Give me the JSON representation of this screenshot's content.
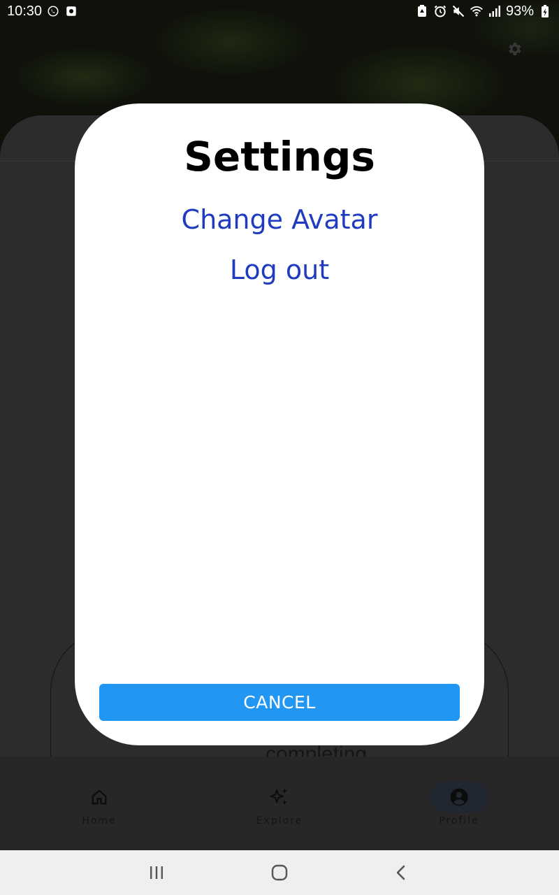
{
  "status_bar": {
    "time": "10:30",
    "battery_pct": "93%",
    "icons": [
      "whatsapp-icon",
      "notification-icon",
      "battery-saver-icon",
      "alarm-icon",
      "mute-icon",
      "wifi-icon",
      "signal-icon",
      "battery-charging-icon"
    ]
  },
  "background_app": {
    "snippet_text": "completing",
    "nav": {
      "items": [
        {
          "label": "Home",
          "icon": "home-icon"
        },
        {
          "label": "Explore",
          "icon": "sparkles-icon"
        },
        {
          "label": "Profile",
          "icon": "account-icon",
          "active": true
        }
      ]
    }
  },
  "dialog": {
    "title": "Settings",
    "items": [
      {
        "label": "Change Avatar"
      },
      {
        "label": "Log out"
      }
    ],
    "cancel_label": "CANCEL"
  },
  "colors": {
    "link": "#1f3bbf",
    "primary_button": "#2196f3",
    "dialog_bg": "#ffffff"
  }
}
